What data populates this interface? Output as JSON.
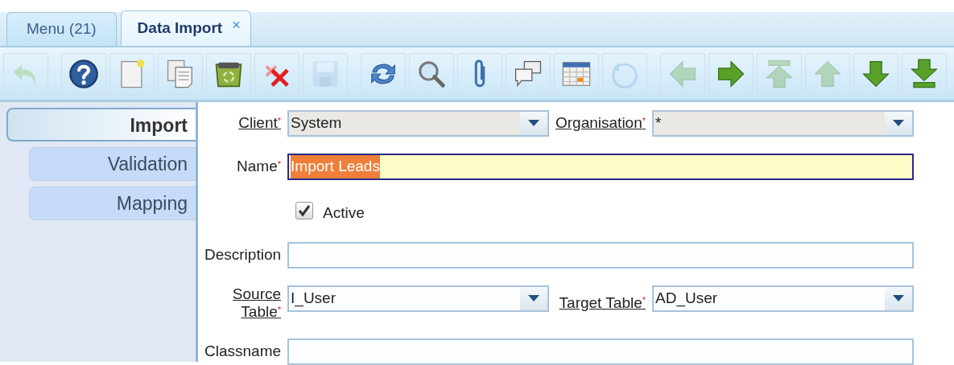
{
  "tabs": [
    {
      "label": "Menu (21)",
      "selected": false
    },
    {
      "label": "Data Import",
      "selected": true,
      "close_glyph": "×"
    }
  ],
  "toolbar": [
    {
      "kind": "undo",
      "disabled": true
    },
    {
      "kind": "help",
      "disabled": false
    },
    {
      "kind": "new",
      "disabled": false
    },
    {
      "kind": "copy",
      "disabled": false
    },
    {
      "kind": "trash",
      "disabled": false
    },
    {
      "kind": "cancel",
      "disabled": false
    },
    {
      "kind": "save",
      "disabled": true
    },
    {
      "kind": "refresh",
      "disabled": false
    },
    {
      "kind": "find",
      "disabled": false
    },
    {
      "kind": "attach",
      "disabled": false
    },
    {
      "kind": "chat",
      "disabled": false
    },
    {
      "kind": "report",
      "disabled": false
    },
    {
      "kind": "history",
      "disabled": true
    },
    {
      "kind": "prev",
      "disabled": true
    },
    {
      "kind": "next",
      "disabled": false
    },
    {
      "kind": "first",
      "disabled": true
    },
    {
      "kind": "up",
      "disabled": true
    },
    {
      "kind": "down",
      "disabled": false
    },
    {
      "kind": "last",
      "disabled": false
    }
  ],
  "sidebar": {
    "items": [
      {
        "label": "Import",
        "selected": true
      },
      {
        "label": "Validation",
        "selected": false
      },
      {
        "label": "Mapping",
        "selected": false
      }
    ]
  },
  "form": {
    "rows": [
      [
        {
          "kind": "select",
          "label": "Client$^{*}$",
          "link": true,
          "value": "System",
          "readonly": true
        },
        {
          "kind": "select",
          "label": "Organisation$^{*}$",
          "link": true,
          "value": "*",
          "readonly": true
        }
      ],
      [
        {
          "kind": "text",
          "label": "Name$^{*}$",
          "link": false,
          "value": "Import Leads",
          "focused": true,
          "text_selected": true
        }
      ],
      [
        {
          "kind": "checkbox",
          "label": "Active",
          "checked": true
        }
      ],
      [
        {
          "kind": "text",
          "label": "Description",
          "link": false,
          "focused": false
        }
      ],
      [
        {
          "kind": "select",
          "label": "Source Table$^{*}$",
          "link": true,
          "value": "I_User",
          "readonly": false
        },
        {
          "kind": "select",
          "label": "Target Table$^{*}$",
          "link": true,
          "value": "AD_User",
          "readonly": false
        }
      ],
      [
        {
          "kind": "text",
          "label": "Classname",
          "link": false,
          "focused": false
        }
      ]
    ]
  }
}
